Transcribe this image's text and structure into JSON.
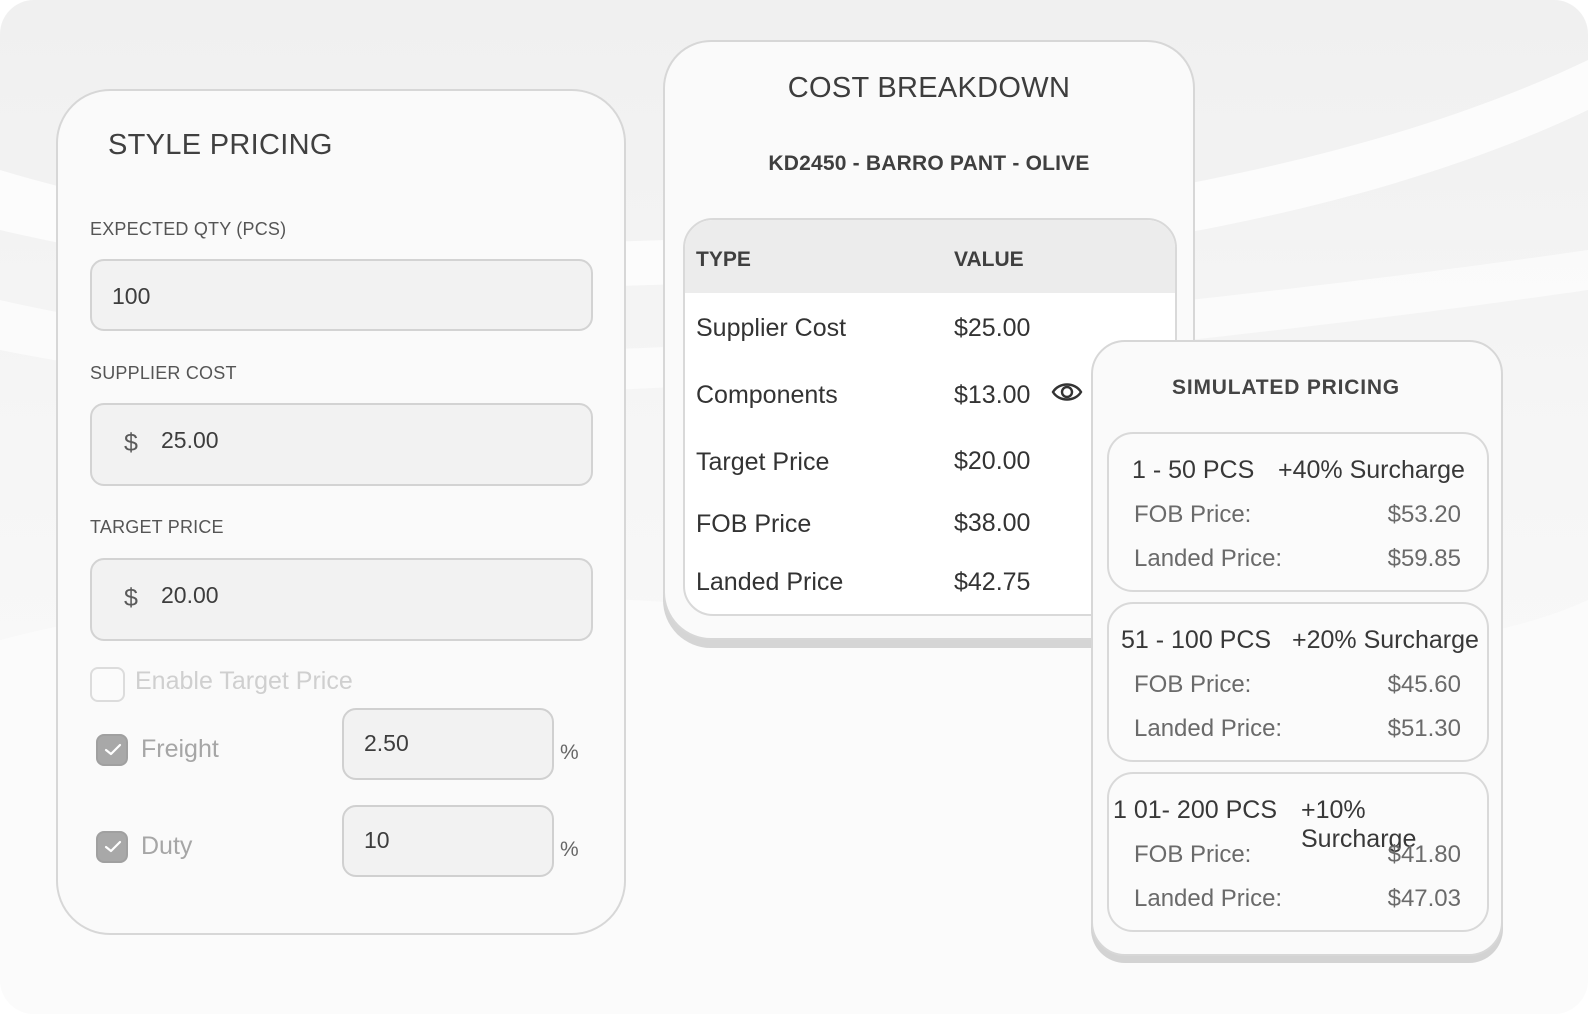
{
  "style_pricing": {
    "title": "STYLE PRICING",
    "expected_qty": {
      "label": "EXPECTED QTY (PCS)",
      "value": "100"
    },
    "supplier_cost": {
      "label": "SUPPLIER COST",
      "currency": "$",
      "value": "25.00"
    },
    "target_price": {
      "label": "TARGET PRICE",
      "currency": "$",
      "value": "20.00"
    },
    "enable_target_price": {
      "label": "Enable Target Price",
      "checked": false
    },
    "freight": {
      "label": "Freight",
      "checked": true,
      "value": "2.50",
      "unit": "%"
    },
    "duty": {
      "label": "Duty",
      "checked": true,
      "value": "10",
      "unit": "%"
    }
  },
  "cost_breakdown": {
    "title": "COST BREAKDOWN",
    "subtitle": "KD2450 - BARRO PANT - OLIVE",
    "columns": [
      "TYPE",
      "VALUE"
    ],
    "rows": [
      {
        "type": "Supplier Cost",
        "value": "$25.00"
      },
      {
        "type": "Components",
        "value": "$13.00"
      },
      {
        "type": "Target Price",
        "value": "$20.00"
      },
      {
        "type": "FOB Price",
        "value": "$38.00"
      },
      {
        "type": "Landed Price",
        "value": "$42.75"
      }
    ],
    "view_icon": "eye-icon"
  },
  "simulated_pricing": {
    "title": "SIMULATED PRICING",
    "tiers": [
      {
        "qty": "1 -  50 PCS",
        "surcharge": "+40% Surcharge",
        "fob_label": "FOB Price:",
        "fob": "$53.20",
        "landed_label": "Landed Price:",
        "landed": "$59.85"
      },
      {
        "qty": "51 -  100 PCS",
        "surcharge": "+20% Surcharge",
        "fob_label": "FOB Price:",
        "fob": "$45.60",
        "landed_label": "Landed Price:",
        "landed": "$51.30"
      },
      {
        "qty": "1 01-  200 PCS",
        "surcharge": "+10% Surcharge",
        "fob_label": "FOB Price:",
        "fob": "$41.80",
        "landed_label": "Landed Price:",
        "landed": "$47.03"
      }
    ]
  },
  "colors": {
    "card_background": "#fafafa",
    "card_border": "#d7d7d7",
    "checkbox_checked": "#a8a8a8",
    "text_primary": "#3a3a3a",
    "text_muted": "#a0a0a0"
  }
}
